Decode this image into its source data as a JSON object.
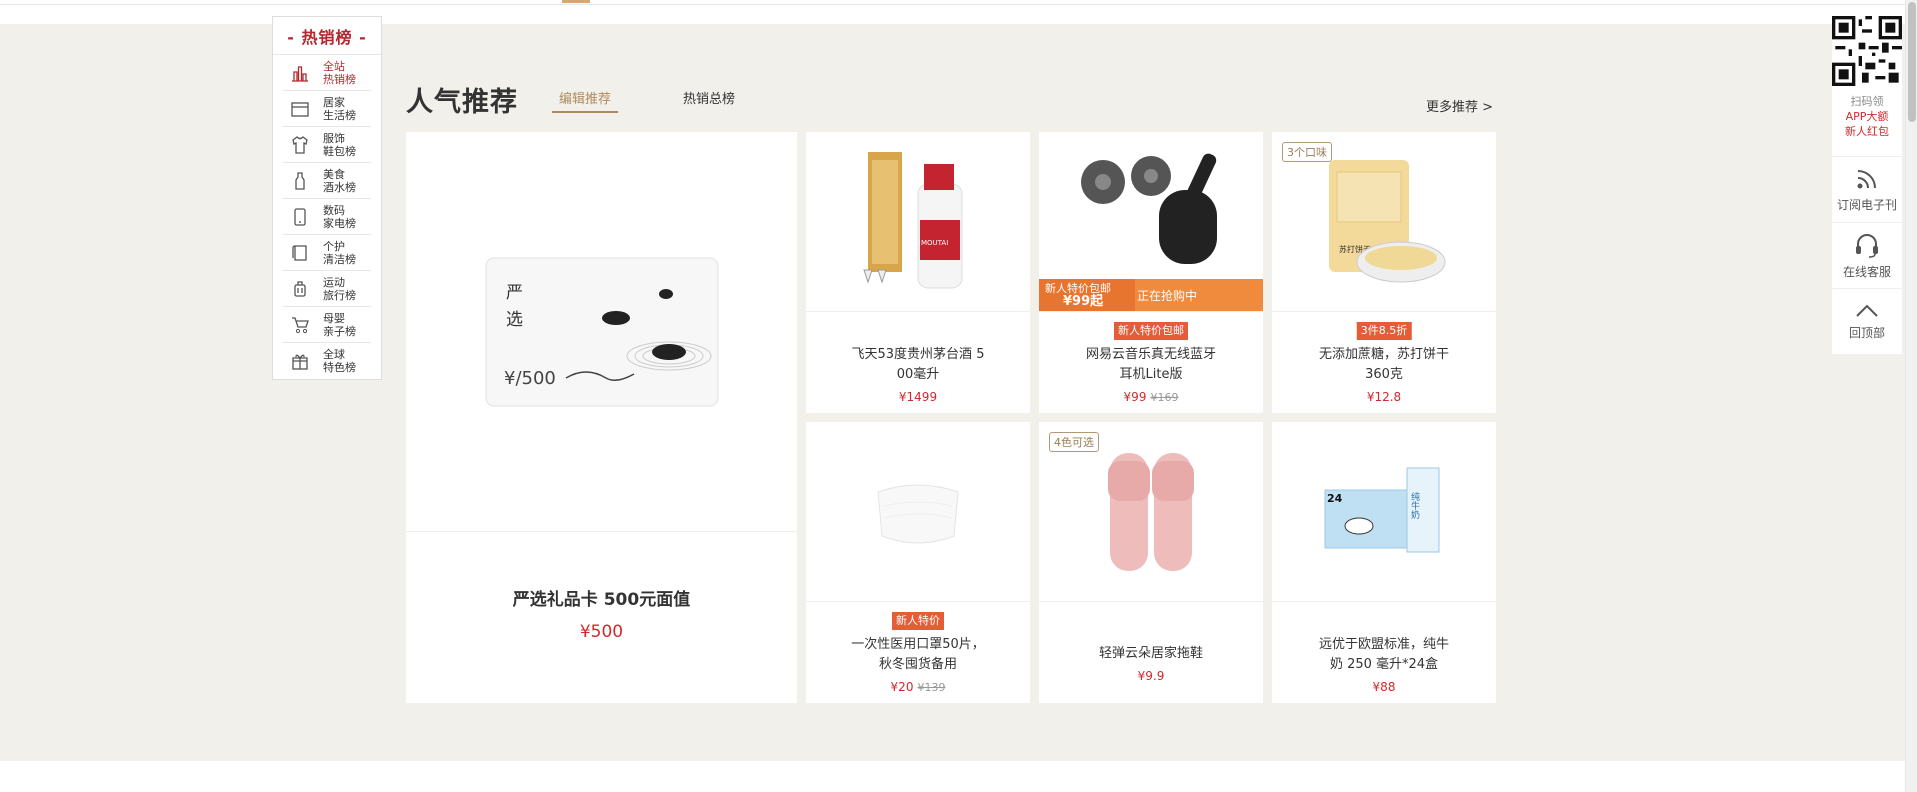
{
  "rank": {
    "title": "- 热销榜 -",
    "items": [
      {
        "label1": "全站",
        "label2": "热销榜",
        "icon": "bar-chart-icon",
        "active": true
      },
      {
        "label1": "居家",
        "label2": "生活榜",
        "icon": "home-goods-icon"
      },
      {
        "label1": "服饰",
        "label2": "鞋包榜",
        "icon": "clothing-icon"
      },
      {
        "label1": "美食",
        "label2": "酒水榜",
        "icon": "bottle-icon"
      },
      {
        "label1": "数码",
        "label2": "家电榜",
        "icon": "phone-icon"
      },
      {
        "label1": "个护",
        "label2": "清洁榜",
        "icon": "towel-icon"
      },
      {
        "label1": "运动",
        "label2": "旅行榜",
        "icon": "luggage-icon"
      },
      {
        "label1": "母婴",
        "label2": "亲子榜",
        "icon": "stroller-icon"
      },
      {
        "label1": "全球",
        "label2": "特色榜",
        "icon": "gift-icon"
      }
    ]
  },
  "header": {
    "title": "人气推荐",
    "tabs": [
      {
        "label": "编辑推荐",
        "active": true
      },
      {
        "label": "热销总榜"
      }
    ],
    "more": "更多推荐 >"
  },
  "big_card": {
    "name": "严选礼品卡 500元面值",
    "price": "¥500",
    "card_text1": "严",
    "card_text2": "选",
    "card_value": "¥/500"
  },
  "products": [
    {
      "name1": "飞天53度贵州茅台酒 5",
      "name2": "00毫升",
      "price": "¥1499",
      "label_text": "MOUTAI"
    },
    {
      "name1": "网易云音乐真无线蓝牙",
      "name2": "耳机Lite版",
      "price": "¥99",
      "old_price": "¥169",
      "tag": "新人特价包邮",
      "promo_left": "新人特价包邮",
      "promo_left_price": "¥99起",
      "promo_right": "正在抢购中"
    },
    {
      "name1": "无添加蔗糖，苏打饼干",
      "name2": "360克",
      "price": "¥12.8",
      "tag": "3件8.5折",
      "flavor": "3个口味",
      "pack_text": "苏打饼干"
    },
    {
      "name1": "一次性医用口罩50片，",
      "name2": "秋冬囤货备用",
      "price": "¥20",
      "old_price": "¥139",
      "tag": "新人特价"
    },
    {
      "name1": "轻弹云朵居家拖鞋",
      "name2": "",
      "price": "¥9.9",
      "flavor": "4色可选"
    },
    {
      "name1": "远优于欧盟标准，纯牛",
      "name2": "奶 250 毫升*24盒",
      "price": "¥88",
      "box_text": "纯牛奶",
      "box_count": "24"
    }
  ],
  "rbar": {
    "qr_line1": "扫码领",
    "qr_line2": "APP大额",
    "qr_line3": "新人红包",
    "subscribe": "订阅电子刊",
    "service": "在线客服",
    "top": "回顶部"
  }
}
